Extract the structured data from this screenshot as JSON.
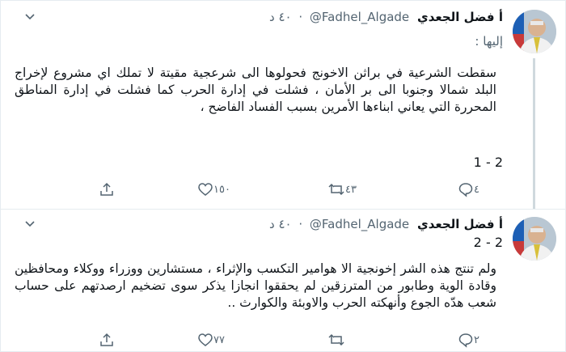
{
  "tweets": [
    {
      "author_name": "أ فضل الجعدي",
      "handle": "@Fadhel_Algade",
      "time": "٤٠ د",
      "dot": "·",
      "reply_to": "إليها :",
      "text": "سقطت الشرعية في براثن الاخونج فحولوها الى شرعجية مقيتة لا تملك اي مشروع لإخراج البلد شمالا وجنوبا الى بر الأمان ، فشلت في إدارة الحرب كما فشلت في إدارة المناطق المحررة التي يعاني ابناءها الأمرين بسبب الفساد الفاضح ،",
      "counter": "2 - 1",
      "actions": {
        "reply_count": "٤",
        "retweet_count": "٤٣",
        "like_count": "١٥٠"
      }
    },
    {
      "author_name": "أ فضل الجعدي",
      "handle": "@Fadhel_Algade",
      "time": "٤٠ د",
      "dot": "·",
      "counter": "2 - 2",
      "text": "ولم تنتج هذه الشر إخونجية الا هوامير التكسب والإثراء ، مستشارين ووزراء ووكلاء ومحافظين وقادة الوية وطابور من المترزقين لم يحققوا انجازا يذكر سوى تضخيم ارصدتهم على حساب شعب هدّه الجوع وأنهكته الحرب والاوبئة والكوارث ..",
      "actions": {
        "reply_count": "٢",
        "retweet_count": "",
        "like_count": "٧٧"
      }
    }
  ],
  "colors": {
    "text": "#0f1419",
    "muted": "#536471",
    "border": "#e6ecf0"
  }
}
